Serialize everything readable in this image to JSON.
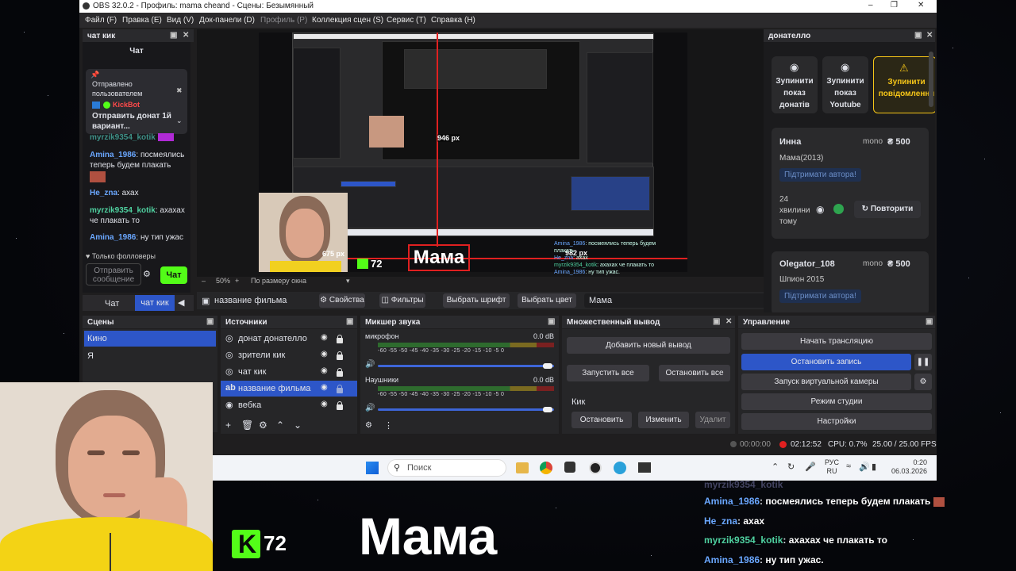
{
  "window": {
    "title": "OBS 32.0.2 - Профиль: mama cheand - Сцены: Безымянный"
  },
  "menu": [
    "Файл (F)",
    "Правка (E)",
    "Вид (V)",
    "Док-панели (D)",
    "Профиль (P)",
    "Коллекция сцен (S)",
    "Сервис (T)",
    "Справка (H)"
  ],
  "chat_dock": {
    "title": "чат кик",
    "header": "Чат",
    "pinned": {
      "sent_by": "Отправлено пользователем",
      "user": "KickBot",
      "text": "Отправить донат 1й вариант..."
    },
    "messages": [
      {
        "user": "myrzik9354_kotik",
        "text": ""
      },
      {
        "user": "Amina_1986",
        "text": "посмеялись теперь будем плакать"
      },
      {
        "user": "He_zna",
        "text": "ахах"
      },
      {
        "user": "myrzik9354_kotik",
        "text": "ахахах че плакать то"
      },
      {
        "user": "Amina_1986",
        "text": "ну тип ужас"
      }
    ],
    "followers_only": "Только фолловеры",
    "input_placeholder": "Отправить сообщение",
    "send_label": "Чат",
    "tabs": [
      "Чат",
      "чат кик"
    ]
  },
  "preview": {
    "zoom": "50%",
    "fit": "По размеру окна",
    "overlay_title": "Мама",
    "kick_count": "72",
    "dim_width": "982 px",
    "dim_height": "675 px",
    "dim_small": "946 px"
  },
  "source_toolbar": {
    "selected": "название фильма",
    "properties": "Свойства",
    "filters": "Фильтры",
    "font": "Выбрать шрифт",
    "color": "Выбрать цвет",
    "text": "Мама"
  },
  "scenes": {
    "title": "Сцены",
    "items": [
      "Кино",
      "Я"
    ]
  },
  "sources": {
    "title": "Источники",
    "items": [
      "донат донателло",
      "зрители кик",
      "чат кик",
      "название фильма",
      "вебка"
    ]
  },
  "mixer": {
    "title": "Микшер звука",
    "channels": [
      {
        "name": "микрофон",
        "db": "0.0 dB"
      },
      {
        "name": "Наушники",
        "db": "0.0 dB"
      }
    ],
    "scale": "-60 -55 -50 -45 -40 -35 -30 -25 -20 -15 -10 -5 0"
  },
  "multi_output": {
    "title": "Множественный вывод",
    "add": "Добавить новый вывод",
    "start_all": "Запустить все",
    "stop_all": "Остановить все",
    "target": "Кик",
    "stop": "Остановить",
    "edit": "Изменить",
    "delete": "Удалит"
  },
  "controls": {
    "title": "Управление",
    "start_stream": "Начать трансляцию",
    "stop_record": "Остановить запись",
    "virtual_cam": "Запуск виртуальной камеры",
    "studio": "Режим студии",
    "settings": "Настройки"
  },
  "status": {
    "stream_time": "00:00:00",
    "rec_time": "02:12:52",
    "cpu": "CPU: 0.7%",
    "fps": "25.00 / 25.00 FPS"
  },
  "donatello": {
    "title": "донателло",
    "buttons": [
      {
        "label": "Зупинити показ донатів"
      },
      {
        "label": "Зупинити показ Youtube"
      },
      {
        "label": "Зупинити повідомлення"
      }
    ],
    "donations": [
      {
        "name": "Инна",
        "method": "mono",
        "amount": "₴ 500",
        "message": "Мама(2013)",
        "support": "Підтримати автора!",
        "time": "24 хвилини тому",
        "repeat": "Повторити"
      },
      {
        "name": "Olegator_108",
        "method": "mono",
        "amount": "₴ 500",
        "message": "Шпион 2015",
        "support": "Підтримати автора!"
      }
    ],
    "accent": "#f5c518"
  },
  "taskbar": {
    "search": "Поиск",
    "lang": "РУС RU",
    "time": "0:20",
    "date": "06.03.2026"
  },
  "overlay": {
    "kick_count": "72",
    "title": "Мама",
    "chat": [
      {
        "user": "Amina_1986",
        "text": "посмеялись теперь будем плакать"
      },
      {
        "user": "He_zna",
        "text": "ахах"
      },
      {
        "user": "myrzik9354_kotik",
        "text": "ахахах че плакать то"
      },
      {
        "user": "Amina_1986",
        "text": "ну тип ужас."
      }
    ]
  },
  "colors": {
    "selection": "#2d56c8",
    "kick_green": "#53fc18",
    "record_red": "#e02020"
  }
}
